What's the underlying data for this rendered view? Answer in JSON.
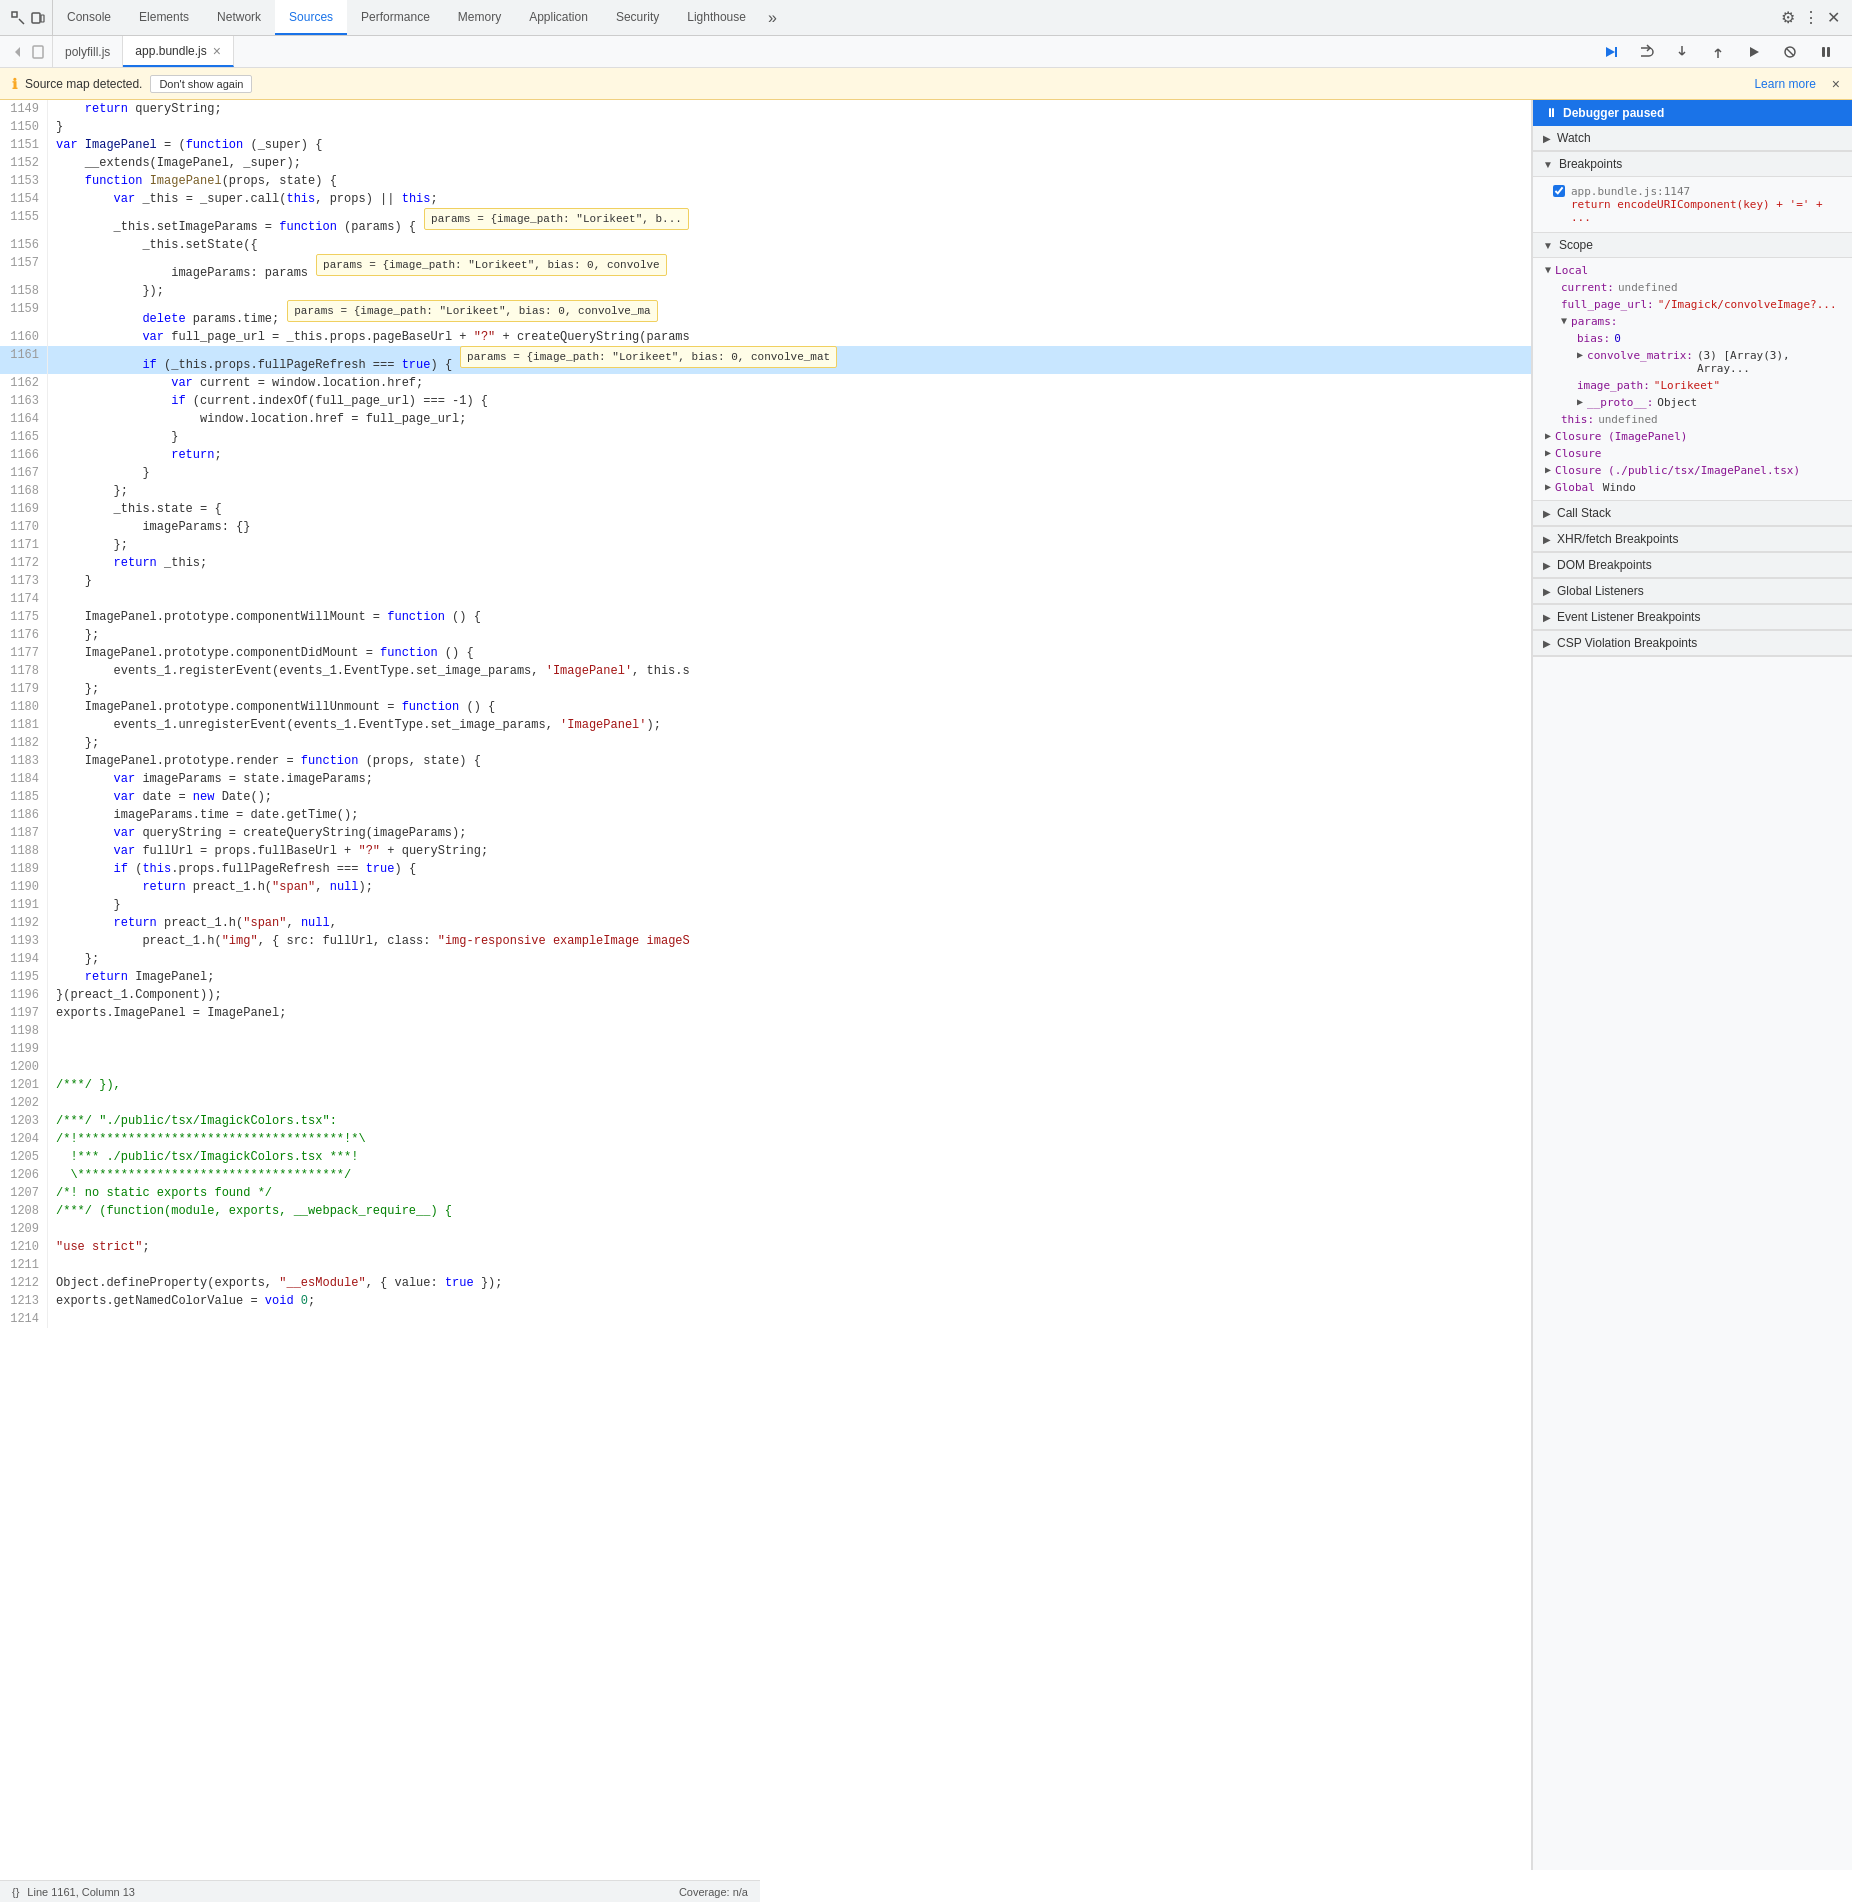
{
  "devtools": {
    "tabs": [
      {
        "id": "console",
        "label": "Console",
        "active": false
      },
      {
        "id": "elements",
        "label": "Elements",
        "active": false
      },
      {
        "id": "network",
        "label": "Network",
        "active": false
      },
      {
        "id": "sources",
        "label": "Sources",
        "active": true
      },
      {
        "id": "performance",
        "label": "Performance",
        "active": false
      },
      {
        "id": "memory",
        "label": "Memory",
        "active": false
      },
      {
        "id": "application",
        "label": "Application",
        "active": false
      },
      {
        "id": "security",
        "label": "Security",
        "active": false
      },
      {
        "id": "lighthouse",
        "label": "Lighthouse",
        "active": false
      }
    ],
    "overflow_label": "»"
  },
  "file_tabs": [
    {
      "id": "polyfill",
      "label": "polyfill.js",
      "active": false,
      "closeable": false
    },
    {
      "id": "app_bundle",
      "label": "app.bundle.js",
      "active": true,
      "closeable": true
    }
  ],
  "info_bar": {
    "icon": "ℹ",
    "message": "Source map detected.",
    "button": "Don't show again",
    "link_text": "Learn more",
    "close": "×"
  },
  "debugger": {
    "status": "Debugger paused",
    "sections": {
      "watch": "Watch",
      "breakpoints": "Breakpoints",
      "scope": "Scope",
      "call_stack": "Call Stack",
      "xhr_fetch": "XHR/fetch Breakpoints",
      "dom_breakpoints": "DOM Breakpoints",
      "global_listeners": "Global Listeners",
      "event_listener": "Event Listener Breakpoints",
      "csp_violation": "CSP Violation Breakpoints"
    },
    "breakpoint": {
      "file": "app.bundle.js:1147",
      "code": "return encodeURIComponent(key) + '=' + ..."
    },
    "scope": {
      "local": {
        "current": "undefined",
        "full_page_url": "\"/Imagick/convolveImage?...",
        "params": {
          "bias": "0",
          "convolve_matrix": "(3) [Array(3), Array...",
          "image_path": "\"Lorikeet\"",
          "__proto__": "Object"
        },
        "this": "undefined"
      },
      "closures": [
        "Closure (ImagePanel)",
        "Closure",
        "Closure (./public/tsx/ImagePanel.tsx)"
      ],
      "global": "Global"
    }
  },
  "status_bar": {
    "cursor": "{}",
    "position": "Line 1161, Column 13",
    "coverage": "Coverage: n/a"
  },
  "code": {
    "lines": [
      {
        "num": 1149,
        "text": "    return queryString;"
      },
      {
        "num": 1150,
        "text": "}"
      },
      {
        "num": 1151,
        "text": "var ImagePanel = (function (_super) {"
      },
      {
        "num": 1152,
        "text": "    __extends(ImagePanel, _super);"
      },
      {
        "num": 1153,
        "text": "    function ImagePanel(props, state) {"
      },
      {
        "num": 1154,
        "text": "        var _this = _super.call(this, props) || this;"
      },
      {
        "num": 1155,
        "text": "        _this.setImageParams = function (params) {"
      },
      {
        "num": 1156,
        "text": "            _this.setState({"
      },
      {
        "num": 1157,
        "text": "                imageParams: params"
      },
      {
        "num": 1158,
        "text": "            });"
      },
      {
        "num": 1159,
        "text": "            delete params.time;"
      },
      {
        "num": 1160,
        "text": "            var full_page_url = _this.props.pageBaseUrl + \"?\" + createQueryString(params"
      },
      {
        "num": 1161,
        "text": "            if (_this.props.fullPageRefresh === true) {",
        "highlighted": true
      },
      {
        "num": 1162,
        "text": "                var current = window.location.href;"
      },
      {
        "num": 1163,
        "text": "                if (current.indexOf(full_page_url) === -1) {"
      },
      {
        "num": 1164,
        "text": "                    window.location.href = full_page_url;"
      },
      {
        "num": 1165,
        "text": "                }"
      },
      {
        "num": 1166,
        "text": "                return;"
      },
      {
        "num": 1167,
        "text": "            }"
      },
      {
        "num": 1168,
        "text": "        };"
      },
      {
        "num": 1169,
        "text": "        _this.state = {"
      },
      {
        "num": 1170,
        "text": "            imageParams: {}"
      },
      {
        "num": 1171,
        "text": "        };"
      },
      {
        "num": 1172,
        "text": "        return _this;"
      },
      {
        "num": 1173,
        "text": "    }"
      },
      {
        "num": 1174,
        "text": ""
      },
      {
        "num": 1175,
        "text": "    ImagePanel.prototype.componentWillMount = function () {"
      },
      {
        "num": 1176,
        "text": "    };"
      },
      {
        "num": 1177,
        "text": "    ImagePanel.prototype.componentDidMount = function () {"
      },
      {
        "num": 1178,
        "text": "        events_1.registerEvent(events_1.EventType.set_image_params, 'ImagePanel', this.s"
      },
      {
        "num": 1179,
        "text": "    };"
      },
      {
        "num": 1180,
        "text": "    ImagePanel.prototype.componentWillUnmount = function () {"
      },
      {
        "num": 1181,
        "text": "        events_1.unregisterEvent(events_1.EventType.set_image_params, 'ImagePanel');"
      },
      {
        "num": 1182,
        "text": "    };"
      },
      {
        "num": 1183,
        "text": "    ImagePanel.prototype.render = function (props, state) {"
      },
      {
        "num": 1184,
        "text": "        var imageParams = state.imageParams;"
      },
      {
        "num": 1185,
        "text": "        var date = new Date();"
      },
      {
        "num": 1186,
        "text": "        imageParams.time = date.getTime();"
      },
      {
        "num": 1187,
        "text": "        var queryString = createQueryString(imageParams);"
      },
      {
        "num": 1188,
        "text": "        var fullUrl = props.fullBaseUrl + \"?\" + queryString;"
      },
      {
        "num": 1189,
        "text": "        if (this.props.fullPageRefresh === true) {"
      },
      {
        "num": 1190,
        "text": "            return preact_1.h(\"span\", null);"
      },
      {
        "num": 1191,
        "text": "        }"
      },
      {
        "num": 1192,
        "text": "        return preact_1.h(\"span\", null,"
      },
      {
        "num": 1193,
        "text": "            preact_1.h(\"img\", { src: fullUrl, class: \"img-responsive exampleImage imageS"
      },
      {
        "num": 1194,
        "text": "    };"
      },
      {
        "num": 1195,
        "text": "    return ImagePanel;"
      },
      {
        "num": 1196,
        "text": "}(preact_1.Component));"
      },
      {
        "num": 1197,
        "text": "exports.ImagePanel = ImagePanel;"
      },
      {
        "num": 1198,
        "text": ""
      },
      {
        "num": 1199,
        "text": ""
      },
      {
        "num": 1200,
        "text": ""
      },
      {
        "num": 1201,
        "text": "/***/ }),"
      },
      {
        "num": 1202,
        "text": ""
      },
      {
        "num": 1203,
        "text": "/***/ \"./public/tsx/ImagickColors.tsx\":"
      },
      {
        "num": 1204,
        "text": "/*!*************************************!*\\"
      },
      {
        "num": 1205,
        "text": "  !*** ./public/tsx/ImagickColors.tsx ***!"
      },
      {
        "num": 1206,
        "text": "  \\*************************************/"
      },
      {
        "num": 1207,
        "text": "/*! no static exports found */"
      },
      {
        "num": 1208,
        "text": "/***/ (function(module, exports, __webpack_require__) {"
      },
      {
        "num": 1209,
        "text": ""
      },
      {
        "num": 1210,
        "text": "\"use strict\";"
      },
      {
        "num": 1211,
        "text": ""
      },
      {
        "num": 1212,
        "text": "Object.defineProperty(exports, \"__esModule\", { value: true });"
      },
      {
        "num": 1213,
        "text": "exports.getNamedColorValue = void 0;"
      },
      {
        "num": 1214,
        "text": ""
      }
    ]
  },
  "tooltips": {
    "line_1155": "params = {image_path: \"Lorikeet\", b...",
    "line_1157": "params = {image_path: \"Lorikeet\", bias: 0, convolve",
    "line_1159": "params = {image_path: \"Lorikeet\", bias: 0, convolve_ma",
    "line_1161": "params = {image_path: \"Lorikeet\", bias: 0, convolve_mat"
  }
}
